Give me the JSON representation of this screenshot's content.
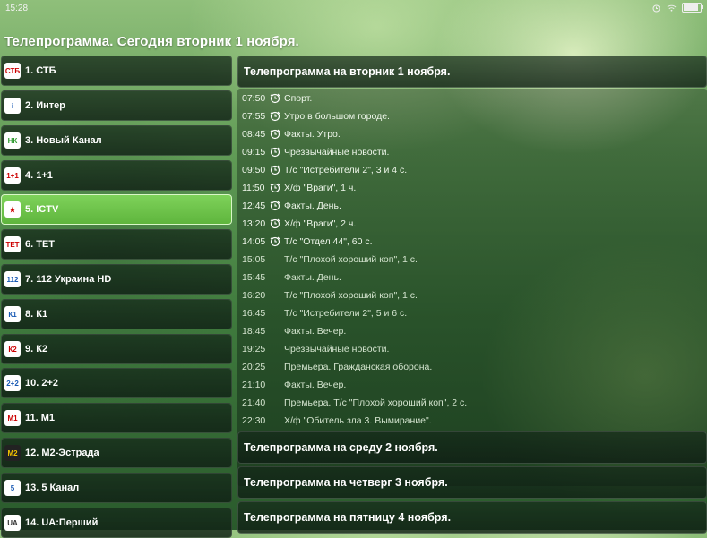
{
  "status_bar": {
    "time": "15:28"
  },
  "page_title": "Телепрограмма. Сегодня вторник  1 ноября.",
  "channels": [
    {
      "label": "1. СТБ",
      "logo": "СТБ"
    },
    {
      "label": "2. Интер",
      "logo": "i"
    },
    {
      "label": "3. Новый Канал",
      "logo": "НК"
    },
    {
      "label": "4. 1+1",
      "logo": "1+1"
    },
    {
      "label": "5. ICTV",
      "logo": "★"
    },
    {
      "label": "6. ТЕТ",
      "logo": "ТЕТ"
    },
    {
      "label": "7. 112 Украина HD",
      "logo": "112"
    },
    {
      "label": "8. К1",
      "logo": "К1"
    },
    {
      "label": "9. К2",
      "logo": "К2"
    },
    {
      "label": "10. 2+2",
      "logo": "2+2"
    },
    {
      "label": "11. М1",
      "logo": "М1"
    },
    {
      "label": "12. М2-Эстрада",
      "logo": "М2"
    },
    {
      "label": "13. 5 Канал",
      "logo": "5"
    },
    {
      "label": "14. UA:Перший",
      "logo": "UA"
    }
  ],
  "active_channel": "5. ICTV",
  "schedule": {
    "today_header": "Телепрограмма на вторник  1 ноября.",
    "programs": [
      {
        "time": "07:50",
        "name": "Спорт."
      },
      {
        "time": "07:55",
        "name": "Утро в большом городе."
      },
      {
        "time": "08:45",
        "name": "Факты. Утро."
      },
      {
        "time": "09:15",
        "name": "Чрезвычайные новости."
      },
      {
        "time": "09:50",
        "name": "Т/с \"Истребители 2\", 3 и 4 с."
      },
      {
        "time": "11:50",
        "name": "Х/ф \"Враги\", 1 ч."
      },
      {
        "time": "12:45",
        "name": "Факты. День."
      },
      {
        "time": "13:20",
        "name": "Х/ф \"Враги\", 2 ч."
      },
      {
        "time": "14:05",
        "name": "Т/с \"Отдел 44\", 60 с."
      },
      {
        "time": "15:05",
        "name": "Т/с \"Плохой хороший коп\", 1 с."
      },
      {
        "time": "15:45",
        "name": "Факты. День."
      },
      {
        "time": "16:20",
        "name": "Т/с \"Плохой хороший коп\", 1 с."
      },
      {
        "time": "16:45",
        "name": "Т/с \"Истребители 2\", 5 и 6 с."
      },
      {
        "time": "18:45",
        "name": "Факты. Вечер."
      },
      {
        "time": "19:25",
        "name": "Чрезвычайные новости."
      },
      {
        "time": "20:25",
        "name": "Премьера. Гражданская оборона."
      },
      {
        "time": "21:10",
        "name": "Факты. Вечер."
      },
      {
        "time": "21:40",
        "name": "Премьера. Т/с \"Плохой хороший коп\", 2 с."
      },
      {
        "time": "22:30",
        "name": "Х/ф \"Обитель зла 3. Вымирание\"."
      }
    ],
    "next_days": [
      "Телепрограмма на среду  2 ноября.",
      "Телепрограмма на четверг  3 ноября.",
      "Телепрограмма на пятницу  4 ноября."
    ]
  }
}
